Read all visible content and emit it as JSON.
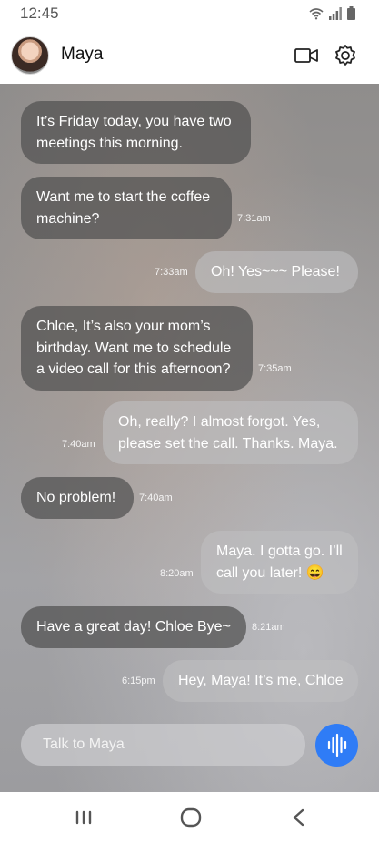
{
  "status_bar": {
    "time": "12:45",
    "icons": [
      "wifi-icon",
      "signal-icon",
      "battery-icon"
    ]
  },
  "header": {
    "contact_name": "Maya",
    "actions": [
      "video-call-icon",
      "settings-icon"
    ]
  },
  "messages": [
    {
      "sender": "Maya",
      "text": "It’s Friday today, you have two meetings this morning.",
      "time": ""
    },
    {
      "sender": "Maya",
      "text": "Want me to start the coffee machine?",
      "time": "7:31am"
    },
    {
      "sender": "Chloe",
      "text": "Oh! Yes~~~ Please!",
      "time": "7:33am"
    },
    {
      "sender": "Maya",
      "text": "Chloe, It’s also your mom’s birthday. Want me to schedule a video call for this afternoon?",
      "time": "7:35am"
    },
    {
      "sender": "Chloe",
      "text": "Oh, really? I almost forgot. Yes, please set the call. Thanks. Maya.",
      "time": "7:40am"
    },
    {
      "sender": "Maya",
      "text": "No problem!",
      "time": "7:40am"
    },
    {
      "sender": "Chloe",
      "text": "Maya. I gotta go. I’ll call you later! 😄",
      "time": "8:20am"
    },
    {
      "sender": "Maya",
      "text": "Have a great day! Chloe Bye~",
      "time": "8:21am"
    },
    {
      "sender": "Chloe",
      "text": "Hey, Maya! It’s me, Chloe",
      "time": "6:15pm"
    }
  ],
  "composer": {
    "placeholder": "Talk to Maya",
    "value": "",
    "voice_button_icon": "voice-wave-icon"
  },
  "nav_bar": {
    "buttons": [
      "recents-icon",
      "home-icon",
      "back-icon"
    ]
  },
  "colors": {
    "accent": "#2f7cf6",
    "incoming_bubble": "#505050",
    "outgoing_bubble": "#bebec0"
  }
}
